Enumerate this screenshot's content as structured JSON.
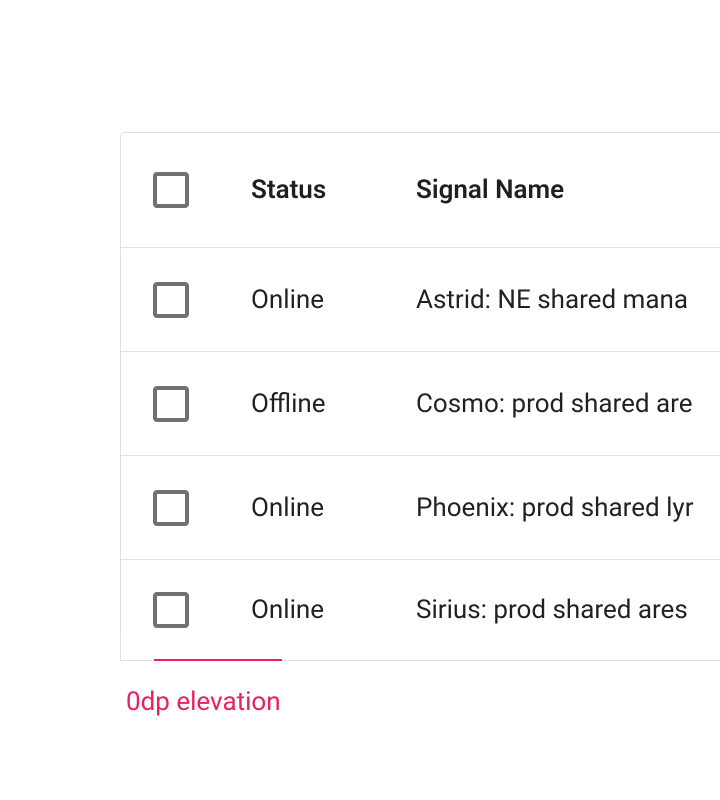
{
  "table": {
    "headers": {
      "status": "Status",
      "signal_name": "Signal Name"
    },
    "rows": [
      {
        "status": "Online",
        "name": "Astrid: NE shared mana"
      },
      {
        "status": "Offline",
        "name": "Cosmo: prod shared are"
      },
      {
        "status": "Online",
        "name": "Phoenix: prod shared lyr"
      },
      {
        "status": "Online",
        "name": "Sirius: prod shared ares"
      }
    ]
  },
  "elevation_label": "0dp elevation"
}
